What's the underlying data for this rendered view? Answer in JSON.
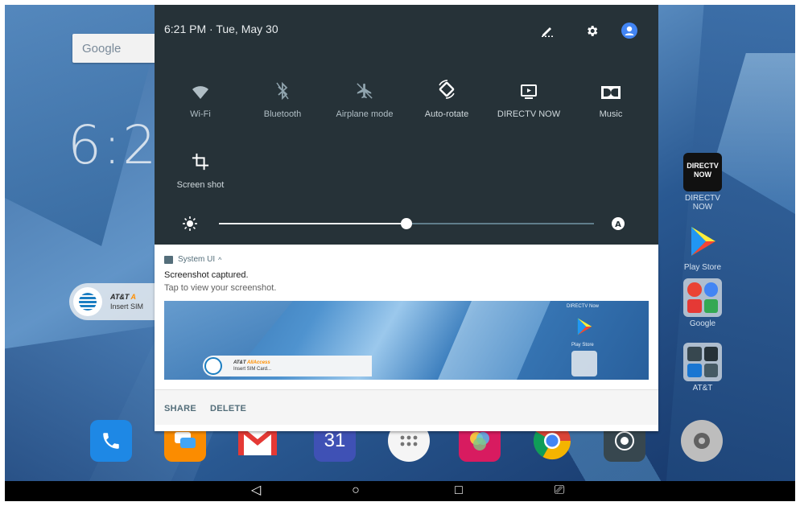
{
  "wallpaper": {
    "google_label": "Google",
    "clock_big": "6:2",
    "att_widget": {
      "title_prefix": "AT&T",
      "title_suffix": "A",
      "subtitle": "Insert SIM"
    },
    "right_apps": [
      {
        "label": "DIRECTV NOW",
        "icon": "directv-now-icon",
        "badge": "DIRECTV NOW"
      },
      {
        "label": "Play Store",
        "icon": "play-store-icon"
      },
      {
        "label": "Google",
        "icon": "google-folder-icon"
      },
      {
        "label": "AT&T",
        "icon": "att-folder-icon"
      }
    ],
    "dock": [
      {
        "name": "phone-icon",
        "color": "#1e88e5"
      },
      {
        "name": "messages-icon",
        "color": "#ff9800"
      },
      {
        "name": "gmail-icon",
        "color": "#e53935"
      },
      {
        "name": "calendar-icon",
        "color": "#3f51b5",
        "text": "31"
      },
      {
        "name": "apps-drawer-icon",
        "color": "#eeeeee"
      },
      {
        "name": "photos-icon",
        "color": "#e91e63"
      },
      {
        "name": "chrome-icon",
        "color": "#4caf50"
      },
      {
        "name": "camera-icon",
        "color": "#37474f"
      },
      {
        "name": "settings-icon",
        "color": "#9e9e9e"
      }
    ]
  },
  "shade": {
    "status_time": "6:21 PM · Tue, May 30",
    "tiles": [
      {
        "label": "Wi-Fi",
        "icon": "wifi-icon",
        "active": false
      },
      {
        "label": "Bluetooth",
        "icon": "bluetooth-icon",
        "active": false
      },
      {
        "label": "Airplane mode",
        "icon": "airplane-icon",
        "active": false
      },
      {
        "label": "Auto-rotate",
        "icon": "auto-rotate-icon",
        "active": true
      },
      {
        "label": "DIRECTV NOW",
        "icon": "cast-icon",
        "active": true
      },
      {
        "label": "Music",
        "icon": "dolby-icon",
        "active": true
      },
      {
        "label": "Screen shot",
        "icon": "crop-icon",
        "active": true
      }
    ],
    "brightness_level": 0.5
  },
  "notification": {
    "app_name": "System UI",
    "expand_glyph": "^",
    "title": "Screenshot captured.",
    "text": "Tap to view your screenshot.",
    "preview": {
      "att_title_prefix": "AT&T",
      "att_title_suffix": "AllAccess",
      "att_subtitle": "Insert SIM Card...",
      "directv_label": "DIRECTV Now",
      "play_label": "Play Store"
    },
    "actions": {
      "share": "SHARE",
      "delete": "DELETE"
    }
  },
  "navbar": {
    "back": "◁",
    "home": "○",
    "recents": "□",
    "screen": "⎚"
  },
  "colors": {
    "shade_bg": "#263238",
    "accent_white": "#ffffff",
    "notif_action": "#546e7a"
  }
}
